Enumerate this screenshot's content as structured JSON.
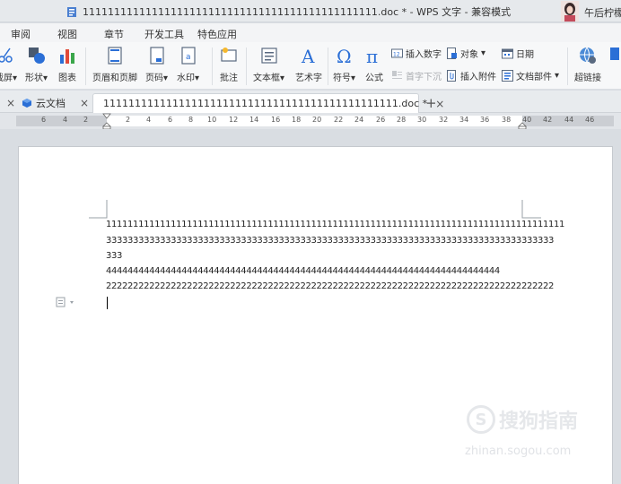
{
  "window": {
    "title": "11111111111111111111111111111111111111111111111.doc * - WPS 文字 - 兼容模式",
    "user_name": "午后柠檬"
  },
  "menu": {
    "items": [
      "审阅",
      "视图",
      "章节",
      "开发工具",
      "特色应用"
    ]
  },
  "ribbon": {
    "screen_label": "截屏",
    "shape_label": "形状",
    "chart_label": "图表",
    "header_footer_label": "页眉和页脚",
    "page_number_label": "页码",
    "watermark_label": "水印",
    "comment_label": "批注",
    "textbox_label": "文本框",
    "wordart_label": "艺术字",
    "symbol_label": "符号",
    "formula_label": "公式",
    "insert_number_label": "插入数字",
    "object_label": "对象",
    "date_label": "日期",
    "dropcap_label": "首字下沉",
    "attach_label": "插入附件",
    "docparts_label": "文档部件",
    "hyperlink_label": "超链接",
    "arrow": "▾"
  },
  "tabs": {
    "cloud_label": "云文档",
    "doc_label": "11111111111111111111111111111111111111111111111.doc *",
    "close": "×",
    "add": "+"
  },
  "ruler": {
    "left_numbers": [
      "6",
      "4",
      "2"
    ],
    "right_numbers": [
      "2",
      "4",
      "6",
      "8",
      "10",
      "12",
      "14",
      "16",
      "18",
      "20",
      "22",
      "24",
      "26",
      "28",
      "30",
      "32",
      "34",
      "36",
      "38",
      "40",
      "42",
      "44",
      "46"
    ]
  },
  "document": {
    "lines": [
      "1111111111111111111111111111111111111111111111111111111111111111111111111111111111111",
      "33333333333333333333333333333333333333333333333333333333333333333333333333333333333",
      "333",
      "4444444444444444444444444444444444444444444444444444444444444444444444444",
      "22222222222222222222222222222222222222222222222222222222222222222222222222222222222"
    ]
  },
  "watermark": {
    "logo_char": "S",
    "text": "搜狗指南",
    "url": "zhinan.sogou.com"
  },
  "colors": {
    "accent_blue": "#2b6fd6",
    "ribbon_bg": "#f7f8f9",
    "page_bg": "#ffffff"
  }
}
